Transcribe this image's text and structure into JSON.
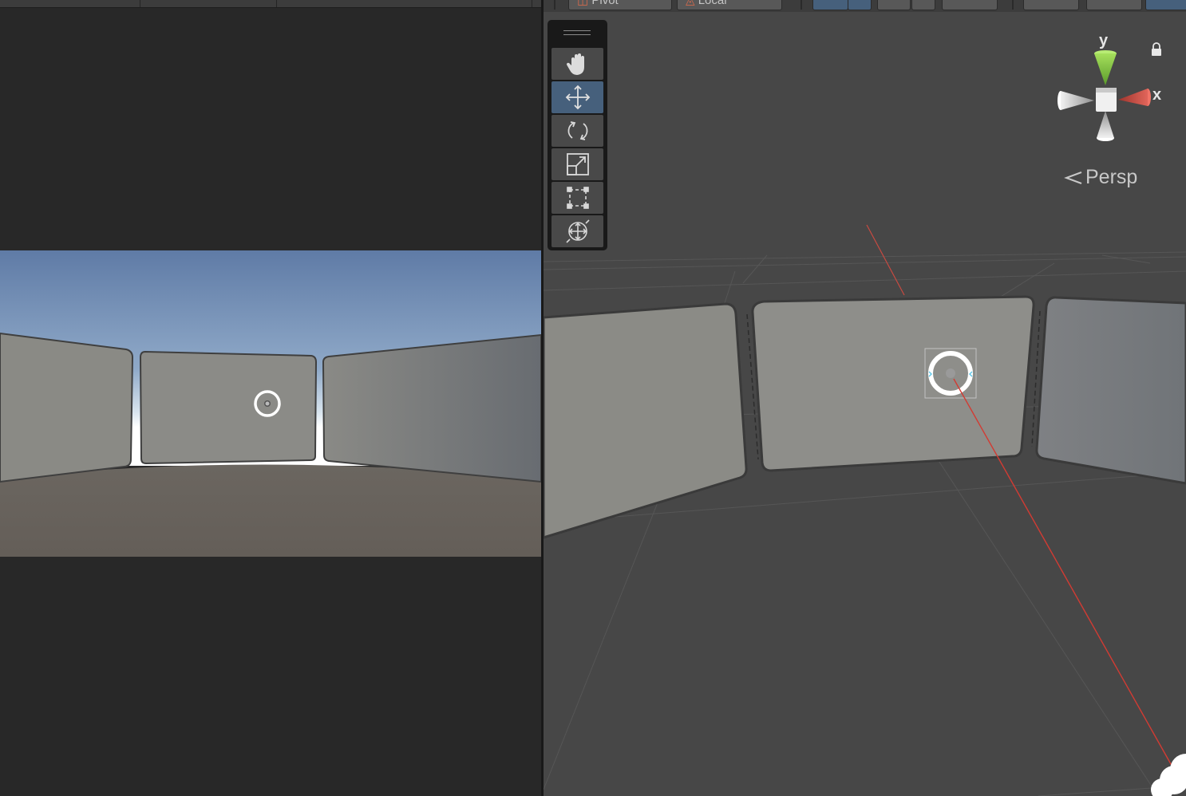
{
  "scene_view": {
    "toolbar": {
      "pivot_label": "Pivot",
      "local_label": "Local"
    },
    "tools": [
      {
        "name": "hand-tool",
        "icon": "hand-icon",
        "active": false
      },
      {
        "name": "move-tool",
        "icon": "move-arrows-icon",
        "active": true
      },
      {
        "name": "rotate-tool",
        "icon": "rotate-icon",
        "active": false
      },
      {
        "name": "scale-tool",
        "icon": "scale-icon",
        "active": false
      },
      {
        "name": "rect-tool",
        "icon": "rect-transform-icon",
        "active": false
      },
      {
        "name": "transform-tool",
        "icon": "transform-icon",
        "active": false
      }
    ],
    "gizmo": {
      "y_label": "y",
      "x_label": "x"
    },
    "projection_label": "Persp"
  },
  "colors": {
    "active_tool": "#46607c",
    "x_axis": "#d9564c",
    "y_axis": "#8ccf4a"
  }
}
